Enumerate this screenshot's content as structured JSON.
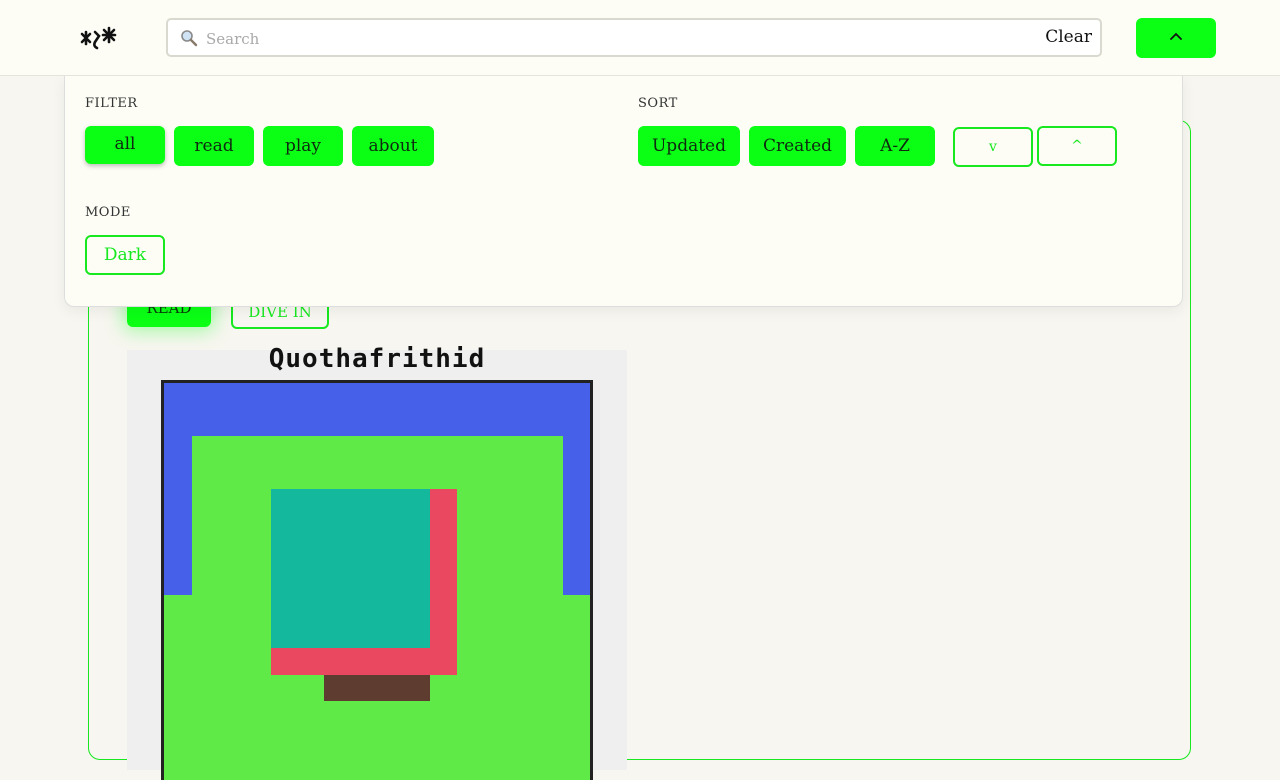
{
  "header": {
    "search": {
      "placeholder": "Search",
      "value": "",
      "clear_label": "Clear"
    },
    "menu_toggle_icon": "chevron-up-icon"
  },
  "panel": {
    "filter": {
      "label": "FILTER",
      "options": [
        "all",
        "read",
        "play",
        "about"
      ],
      "selected": "all"
    },
    "sort": {
      "label": "SORT",
      "options": [
        "Updated",
        "Created",
        "A-Z"
      ],
      "order_descending": "v",
      "order_ascending": "^"
    },
    "mode": {
      "label": "MODE",
      "value": "Dark"
    }
  },
  "card": {
    "read_label": "READ",
    "dive_label": "DIVE IN",
    "preview_title": "Quothafrithid"
  },
  "colors": {
    "accent": "#0aff15",
    "accent_border": "#18e81f",
    "art_blue": "#4760ea",
    "art_green": "#60ea47",
    "art_teal": "#14b89c",
    "art_red": "#ea4760",
    "art_brown": "#5e3c30"
  }
}
